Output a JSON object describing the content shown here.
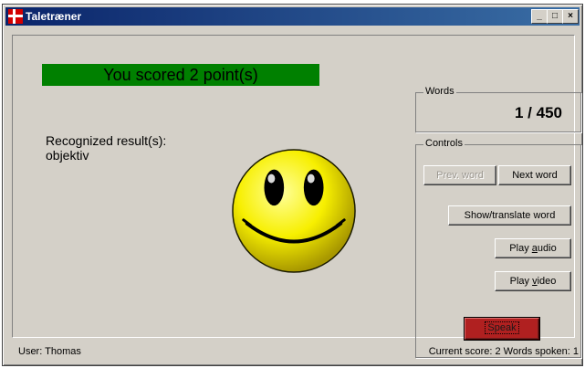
{
  "window": {
    "title": "Taletræner"
  },
  "score": {
    "message": "You scored 2 point(s)",
    "bar_color": "#008000"
  },
  "recognized": {
    "label": "Recognized result(s):",
    "value": "objektiv"
  },
  "words": {
    "group_label": "Words",
    "count": "1 / 450"
  },
  "controls": {
    "group_label": "Controls",
    "prev_label": "Prev. word",
    "next_label": "Next word",
    "show_label": "Show/translate word",
    "audio_pre": "Play ",
    "audio_key": "a",
    "audio_post": "udio",
    "video_pre": "Play ",
    "video_key": "v",
    "video_post": "ideo",
    "speak_label": "Speak",
    "speak_color": "#b02020"
  },
  "status": {
    "user": "User:  Thomas",
    "stats": "Current score: 2 Words spoken: 1"
  }
}
